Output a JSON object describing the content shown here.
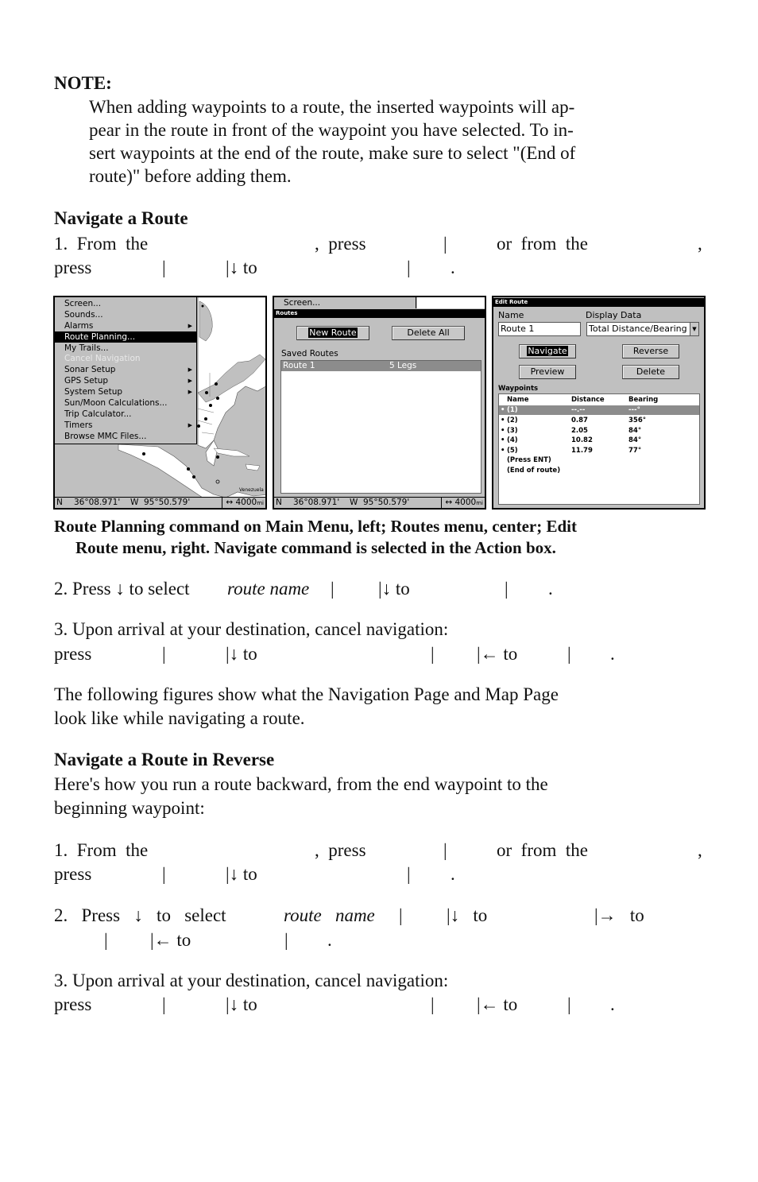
{
  "note": {
    "heading": "NOTE:",
    "lines": [
      "When adding waypoints to a route, the inserted waypoints will ap-",
      "pear in the route in front of the waypoint you have selected. To in-",
      "sert waypoints at the end of the route, make sure to select \"(End of",
      "route)\" before adding them."
    ]
  },
  "section1": {
    "heading": "Navigate a Route",
    "step1": {
      "a": "1.  From  the",
      "b": ",  press",
      "c": "|",
      "d": "or  from  the",
      "e": ",",
      "f": "press",
      "g": "|",
      "h": "|↓ to",
      "i": "|",
      "j": "."
    },
    "caption": [
      "Route Planning command on Main Menu, left; Routes menu, center; Edit",
      "Route menu, right. Navigate command is selected in the Action box."
    ],
    "step2": {
      "a": "2. Press ↓ to select ",
      "b": "route name",
      "c": "|",
      "d": "|↓ to",
      "e": "|",
      "f": "."
    },
    "step3": {
      "line1": "3. Upon arrival at your destination, cancel navigation:",
      "a": "press",
      "b": "|",
      "c": "|↓ to",
      "d": "|",
      "e": "|← to",
      "f": "|",
      "g": "."
    },
    "following": [
      "The following figures show what the Navigation Page and Map Page",
      "look like while navigating a route."
    ]
  },
  "section2": {
    "heading": "Navigate a Route in Reverse",
    "intro": [
      "Here's how you run a route backward, from the end waypoint to the",
      "beginning waypoint:"
    ],
    "step1": {
      "a": "1.  From  the",
      "b": ",  press",
      "c": "|",
      "d": "or  from  the",
      "e": ",",
      "f": "press",
      "g": "|",
      "h": "|↓ to",
      "i": "|",
      "j": "."
    },
    "step2": {
      "a": "2.   Press   ↓   to   select   ",
      "b": "route   name",
      "c": "|",
      "d": "|↓   to",
      "e": "|→   to",
      "f": "|",
      "g": "|← to",
      "h": "|",
      "i": "."
    },
    "step3": {
      "line1": "3. Upon arrival at your destination, cancel navigation:",
      "a": "press",
      "b": "|",
      "c": "|↓ to",
      "d": "|",
      "e": "|← to",
      "f": "|",
      "g": "."
    }
  },
  "screens": {
    "main_menu": {
      "items": [
        {
          "label": "Screen...",
          "submenu": false,
          "state": "normal"
        },
        {
          "label": "Sounds...",
          "submenu": false,
          "state": "normal"
        },
        {
          "label": "Alarms",
          "submenu": true,
          "state": "normal"
        },
        {
          "label": "Route Planning...",
          "submenu": false,
          "state": "selected"
        },
        {
          "label": "My Trails...",
          "submenu": false,
          "state": "normal"
        },
        {
          "label": "Cancel Navigation",
          "submenu": false,
          "state": "disabled"
        },
        {
          "label": "Sonar Setup",
          "submenu": true,
          "state": "normal"
        },
        {
          "label": "GPS Setup",
          "submenu": true,
          "state": "normal"
        },
        {
          "label": "System Setup",
          "submenu": true,
          "state": "normal"
        },
        {
          "label": "Sun/Moon Calculations...",
          "submenu": false,
          "state": "normal"
        },
        {
          "label": "Trip Calculator...",
          "submenu": false,
          "state": "normal"
        },
        {
          "label": "Timers",
          "submenu": true,
          "state": "normal"
        },
        {
          "label": "Browse MMC Files...",
          "submenu": false,
          "state": "normal"
        }
      ],
      "map_label": "Venezuela",
      "status": {
        "lat_hemi": "N",
        "lat": "36°08.971'",
        "lon_hemi": "W",
        "lon": "95°50.579'",
        "scale_icon": "↔",
        "scale": "4000",
        "unit": "mi"
      }
    },
    "routes": {
      "behind_menu_item": "Screen...",
      "title": "Routes",
      "new_route": "New Route",
      "delete_all": "Delete All",
      "saved_label": "Saved Routes",
      "saved": [
        {
          "name": "Route 1",
          "legs": "5 Legs"
        }
      ],
      "status": {
        "lat_hemi": "N",
        "lat": "36°08.971'",
        "lon_hemi": "W",
        "lon": "95°50.579'",
        "scale_icon": "↔",
        "scale": "4000",
        "unit": "mi"
      }
    },
    "edit_route": {
      "title": "Edit Route",
      "name_label": "Name",
      "name_value": "Route 1",
      "display_label": "Display Data",
      "display_value": "Total Distance/Bearing",
      "navigate": "Navigate",
      "reverse": "Reverse",
      "preview": "Preview",
      "delete": "Delete",
      "waypoints_label": "Waypoints",
      "columns": [
        "Name",
        "Distance",
        "Bearing"
      ],
      "rows": [
        {
          "bullet": "•",
          "name": "(1)",
          "distance": "--.--",
          "bearing": "---°",
          "selected": true
        },
        {
          "bullet": "•",
          "name": "(2)",
          "distance": "0.87",
          "bearing": "356°"
        },
        {
          "bullet": "•",
          "name": "(3)",
          "distance": "2.05",
          "bearing": "84°"
        },
        {
          "bullet": "•",
          "name": "(4)",
          "distance": "10.82",
          "bearing": "84°"
        },
        {
          "bullet": "•",
          "name": "(5)",
          "distance": "11.79",
          "bearing": "77°"
        },
        {
          "bullet": "",
          "name": "(Press ENT)",
          "distance": "",
          "bearing": ""
        },
        {
          "bullet": "",
          "name": "(End of route)",
          "distance": "",
          "bearing": ""
        }
      ]
    }
  }
}
